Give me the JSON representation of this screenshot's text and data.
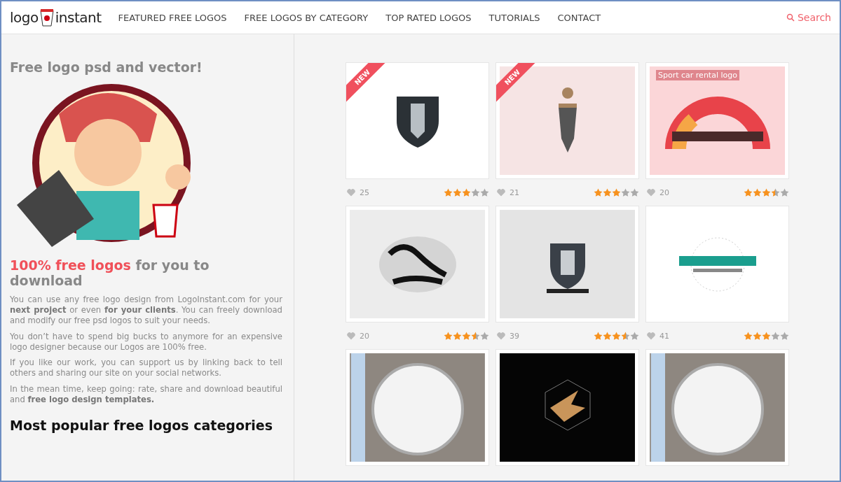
{
  "header": {
    "logo": {
      "left": "logo",
      "right": "instant"
    },
    "nav": [
      {
        "label": "FEATURED FREE LOGOS"
      },
      {
        "label": "FREE LOGOS BY CATEGORY"
      },
      {
        "label": "TOP RATED LOGOS"
      },
      {
        "label": "TUTORIALS"
      },
      {
        "label": "CONTACT"
      }
    ],
    "search": "Search"
  },
  "sidebar": {
    "title": "Free logo psd and vector!",
    "heading_accent": "100% free logos",
    "heading_rest": " for you to download",
    "paragraphs": [
      "You can use any free logo design from LogoInstant.com for your **next project** or even **for your clients**. You can freely download and modify our free psd logos to suit your needs.",
      "You don’t have to spend big bucks to anymore for an expensive logo designer because our Logos are 100% free.",
      "If you like our work, you can support us by linking back to tell others and sharing our site on your social networks.",
      "In the mean time, keep going: rate, share and download beautiful and **free logo design templates.**"
    ],
    "section_title": "Most popular free logos categories"
  },
  "logos": [
    {
      "kind": "shield",
      "badge": "NEW",
      "likes": "25",
      "stars": 3
    },
    {
      "kind": "pen",
      "badge": "NEW",
      "likes": "21",
      "stars": 3
    },
    {
      "kind": "gauge",
      "overlay_title": "Sport car rental logo",
      "likes": "20",
      "stars": 3.5
    },
    {
      "kind": "script",
      "likes": "20",
      "stars": 3.5
    },
    {
      "kind": "helmet",
      "likes": "39",
      "stars": 3.5
    },
    {
      "kind": "globe",
      "likes": "41",
      "stars": 3
    },
    {
      "kind": "sign"
    },
    {
      "kind": "lion"
    },
    {
      "kind": "sign"
    }
  ]
}
